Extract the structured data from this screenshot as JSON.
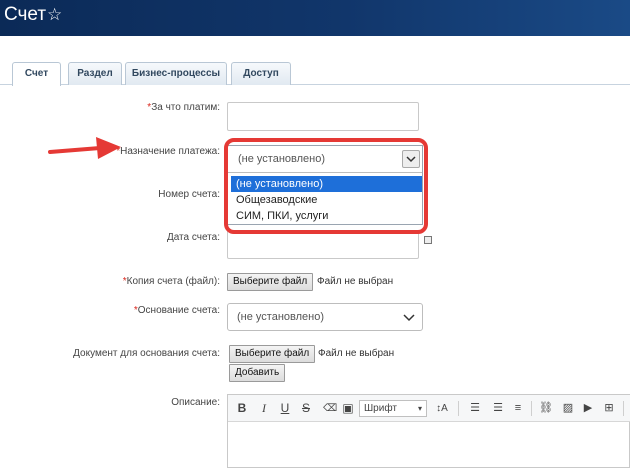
{
  "header": {
    "title": "Счет",
    "star_icon": "star-outline-icon"
  },
  "tabs": [
    {
      "label": "Счет",
      "active": true
    },
    {
      "label": "Раздел",
      "active": false
    },
    {
      "label": "Бизнес-процессы",
      "active": false
    },
    {
      "label": "Доступ",
      "active": false
    }
  ],
  "form": {
    "pay_for": {
      "label": "За что платим:",
      "required": "*",
      "value": ""
    },
    "purpose": {
      "label": "Назначение платежа:",
      "required": "*",
      "selected": "(не установлено)",
      "options": [
        "(не установлено)",
        "Общезаводские",
        "СИМ, ПКИ, услуги"
      ]
    },
    "invoice_number": {
      "label": "Номер счета:",
      "value": ""
    },
    "invoice_date": {
      "label": "Дата счета:",
      "value": "",
      "calendar_icon": "calendar-icon"
    },
    "invoice_copy": {
      "label": "Копия счета (файл):",
      "required": "*",
      "button": "Выберите файл",
      "status": "Файл не выбран"
    },
    "basis": {
      "label": "Основание счета:",
      "required": "*",
      "selected": "(не установлено)"
    },
    "basis_doc": {
      "label": "Документ для основания счета:",
      "button": "Выберите файл",
      "status": "Файл не выбран",
      "add_button": "Добавить"
    },
    "description": {
      "label": "Описание:",
      "font_select": "Шрифт"
    }
  },
  "annotation": {
    "arrow_color": "#e53935",
    "highlight_color": "#e53935"
  }
}
